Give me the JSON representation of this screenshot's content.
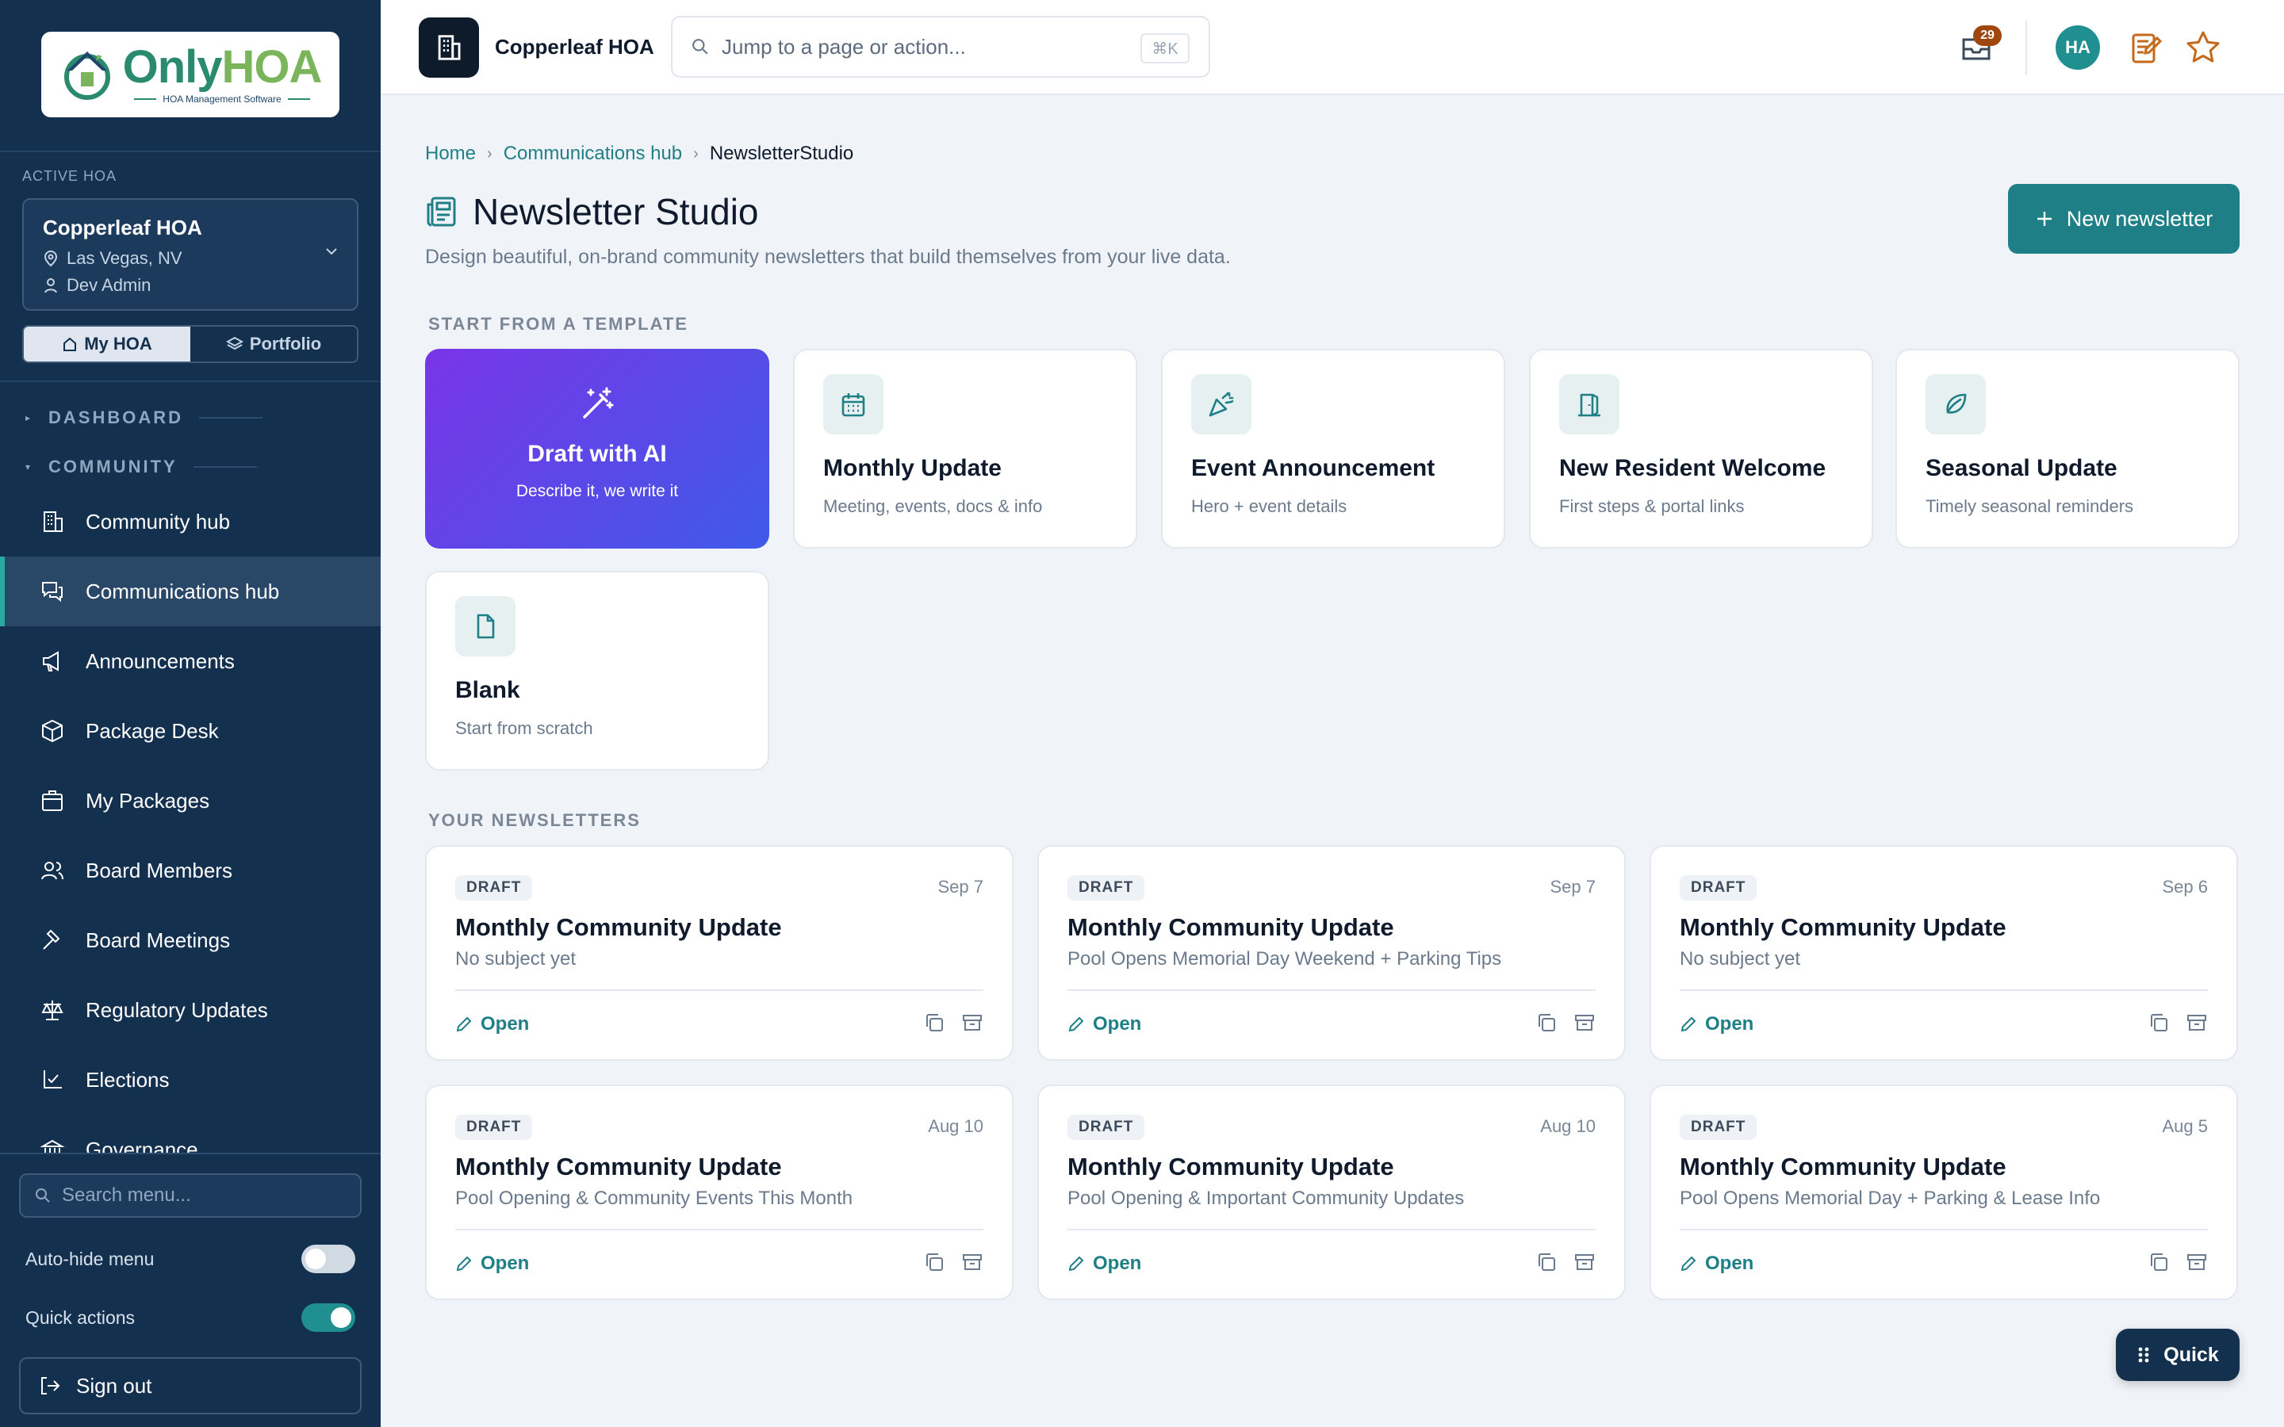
{
  "brand": {
    "logo_only": "Only",
    "logo_hoa": "HOA",
    "logo_tagline": "HOA Management Software",
    "accent": "#1f7f86",
    "sidebar_bg": "#14304f"
  },
  "sidebar": {
    "active_label": "ACTIVE HOA",
    "hoa": {
      "name": "Copperleaf HOA",
      "location": "Las Vegas, NV",
      "user": "Dev Admin"
    },
    "segments": [
      {
        "label": "My HOA",
        "icon": "home-icon",
        "active": true
      },
      {
        "label": "Portfolio",
        "icon": "layers-icon",
        "active": false
      }
    ],
    "sections": {
      "dashboard": "DASHBOARD",
      "community": "COMMUNITY"
    },
    "items": [
      {
        "label": "Community hub",
        "icon": "building-icon"
      },
      {
        "label": "Communications hub",
        "icon": "chat-icon",
        "active": true
      },
      {
        "label": "Announcements",
        "icon": "megaphone-icon"
      },
      {
        "label": "Package Desk",
        "icon": "box-icon"
      },
      {
        "label": "My Packages",
        "icon": "package-icon"
      },
      {
        "label": "Board Members",
        "icon": "users-icon"
      },
      {
        "label": "Board Meetings",
        "icon": "gavel-icon"
      },
      {
        "label": "Regulatory Updates",
        "icon": "scale-icon"
      },
      {
        "label": "Elections",
        "icon": "vote-icon"
      },
      {
        "label": "Governance",
        "icon": "bank-icon"
      }
    ],
    "search_placeholder": "Search menu...",
    "auto_hide_label": "Auto-hide menu",
    "auto_hide_on": false,
    "quick_actions_label": "Quick actions",
    "quick_actions_on": true,
    "sign_out": "Sign out"
  },
  "topbar": {
    "app_name": "Copperleaf HOA",
    "search_placeholder": "Jump to a page or action...",
    "shortcut": "⌘K",
    "inbox_count": "29",
    "avatar_initials": "HA"
  },
  "breadcrumb": [
    "Home",
    "Communications hub",
    "NewsletterStudio"
  ],
  "page": {
    "title": "Newsletter Studio",
    "subtitle": "Design beautiful, on-brand community newsletters that build themselves from your live data.",
    "new_button": "New newsletter"
  },
  "templates_label": "START FROM A TEMPLATE",
  "templates": [
    {
      "title": "Draft with AI",
      "desc": "Describe it, we write it",
      "icon": "magic-wand-icon"
    },
    {
      "title": "Monthly Update",
      "desc": "Meeting, events, docs & info",
      "icon": "calendar-icon"
    },
    {
      "title": "Event Announcement",
      "desc": "Hero + event details",
      "icon": "party-popper-icon"
    },
    {
      "title": "New Resident Welcome",
      "desc": "First steps & portal links",
      "icon": "door-icon"
    },
    {
      "title": "Seasonal Update",
      "desc": "Timely seasonal reminders",
      "icon": "leaf-icon"
    },
    {
      "title": "Blank",
      "desc": "Start from scratch",
      "icon": "file-icon"
    }
  ],
  "newsletters_label": "YOUR NEWSLETTERS",
  "newsletters": [
    {
      "status": "DRAFT",
      "date": "Sep 7",
      "title": "Monthly Community Update",
      "subject": "No subject yet",
      "open": "Open"
    },
    {
      "status": "DRAFT",
      "date": "Sep 7",
      "title": "Monthly Community Update",
      "subject": "Pool Opens Memorial Day Weekend + Parking Tips",
      "open": "Open"
    },
    {
      "status": "DRAFT",
      "date": "Sep 6",
      "title": "Monthly Community Update",
      "subject": "No subject yet",
      "open": "Open"
    },
    {
      "status": "DRAFT",
      "date": "Aug 10",
      "title": "Monthly Community Update",
      "subject": "Pool Opening & Community Events This Month",
      "open": "Open"
    },
    {
      "status": "DRAFT",
      "date": "Aug 10",
      "title": "Monthly Community Update",
      "subject": "Pool Opening & Important Community Updates",
      "open": "Open"
    },
    {
      "status": "DRAFT",
      "date": "Aug 5",
      "title": "Monthly Community Update",
      "subject": "Pool Opens Memorial Day + Parking & Lease Info",
      "open": "Open"
    }
  ],
  "quick_button": "Quick"
}
